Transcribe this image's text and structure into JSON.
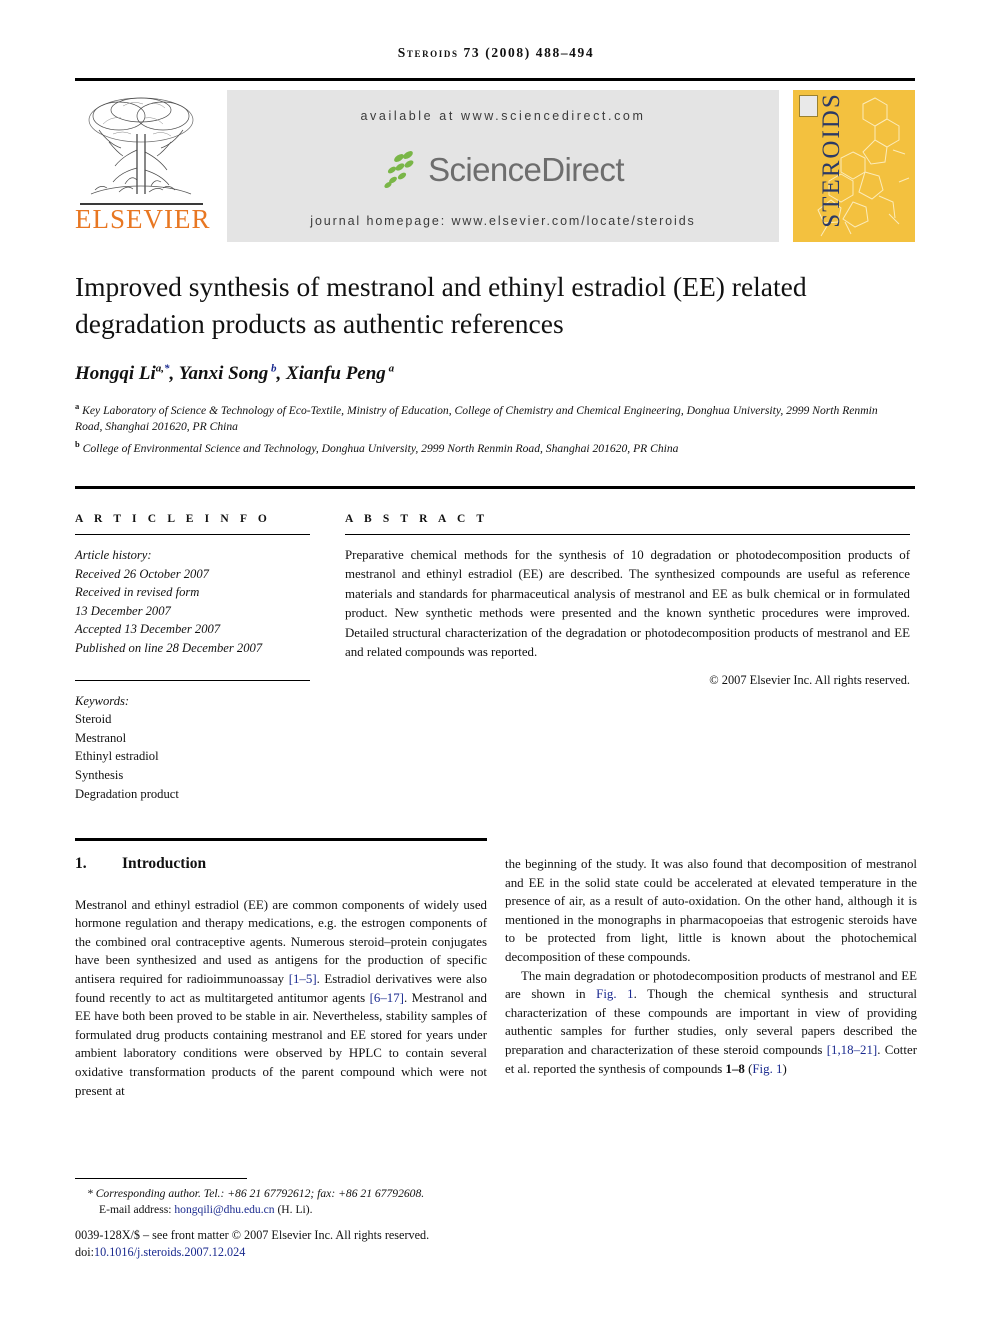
{
  "running_head": "Steroids 73 (2008) 488–494",
  "banner": {
    "elsevier_wordmark": "ELSEVIER",
    "available_at": "available at www.sciencedirect.com",
    "sciencedirect_wordmark": "ScienceDirect",
    "journal_homepage": "journal homepage: www.elsevier.com/locate/steroids",
    "cover_title": "STEROIDS",
    "colors": {
      "elsevier_orange": "#E87722",
      "sciencedirect_grey": "#6d6d6d",
      "sciencedirect_green": "#7ab648",
      "cover_yellow": "#F3C13F",
      "cover_navy": "#2b3a66",
      "banner_grey": "#e4e4e4"
    }
  },
  "article": {
    "title": "Improved synthesis of mestranol and ethinyl estradiol (EE) related degradation products as authentic references",
    "authors": "Hongqi Li a,*, Yanxi Song b, Xianfu Peng a",
    "affiliation_a": "Key Laboratory of Science & Technology of Eco-Textile, Ministry of Education, College of Chemistry and Chemical Engineering, Donghua University, 2999 North Renmin Road, Shanghai 201620, PR China",
    "affiliation_b": "College of Environmental Science and Technology, Donghua University, 2999 North Renmin Road, Shanghai 201620, PR China"
  },
  "info": {
    "heading": "A R T I C L E   I N F O",
    "history_label": "Article history:",
    "history": [
      "Received 26 October 2007",
      "Received in revised form",
      "13 December 2007",
      "Accepted 13 December 2007",
      "Published on line 28 December 2007"
    ],
    "keywords_label": "Keywords:",
    "keywords": [
      "Steroid",
      "Mestranol",
      "Ethinyl estradiol",
      "Synthesis",
      "Degradation product"
    ]
  },
  "abstract": {
    "heading": "A B S T R A C T",
    "text": "Preparative chemical methods for the synthesis of 10 degradation or photodecomposition products of mestranol and ethinyl estradiol (EE) are described. The synthesized compounds are useful as reference materials and standards for pharmaceutical analysis of mestranol and EE as bulk chemical or in formulated product. New synthetic methods were presented and the known synthetic procedures were improved. Detailed structural characterization of the degradation or photodecomposition products of mestranol and EE and related compounds was reported.",
    "copyright": "© 2007 Elsevier Inc. All rights reserved."
  },
  "body": {
    "section_number": "1.",
    "section_title": "Introduction",
    "left_p1_a": "Mestranol and ethinyl estradiol (EE) are common components of widely used hormone regulation and therapy medications, e.g. the estrogen components of the combined oral contraceptive agents. Numerous steroid–protein conjugates have been synthesized and used as antigens for the production of specific antisera required for radioimmunoassay ",
    "left_cite1": "[1–5]",
    "left_p1_b": ". Estradiol derivatives were also found recently to act as multitargeted antitumor agents ",
    "left_cite2": "[6–17]",
    "left_p1_c": ". Mestranol and EE have both been proved to be stable in air. Nevertheless, stability samples of formulated drug products containing mestranol and EE stored for years under ambient laboratory conditions were observed by HPLC to contain several oxidative transformation products of the parent compound which were not present at",
    "right_p1": "the beginning of the study. It was also found that decomposition of mestranol and EE in the solid state could be accelerated at elevated temperature in the presence of air, as a result of auto-oxidation. On the other hand, although it is mentioned in the monographs in pharmacopoeias that estrogenic steroids have to be protected from light, little is known about the photochemical decomposition of these compounds.",
    "right_p2_a": "The main degradation or photodecomposition products of mestranol and EE are shown in ",
    "right_cite_fig1": "Fig. 1",
    "right_p2_b": ". Though the chemical synthesis and structural characterization of these compounds are important in view of providing authentic samples for further studies, only several papers described the preparation and characterization of these steroid compounds ",
    "right_cite3": "[1,18–21]",
    "right_p2_c": ". Cotter et al. reported the synthesis of compounds ",
    "right_cite_cmpd": "1–8",
    "right_p2_d": " (",
    "right_cite_fig1b": "Fig. 1",
    "right_p2_e": ")"
  },
  "footer": {
    "corresponding": "* Corresponding author. Tel.: +86 21 67792612; fax: +86 21 67792608.",
    "email_label": "E-mail address: ",
    "email": "hongqili@dhu.edu.cn",
    "email_suffix": " (H. Li).",
    "front_matter": "0039-128X/$ – see front matter © 2007 Elsevier Inc. All rights reserved.",
    "doi_label": "doi:",
    "doi": "10.1016/j.steroids.2007.12.024"
  }
}
